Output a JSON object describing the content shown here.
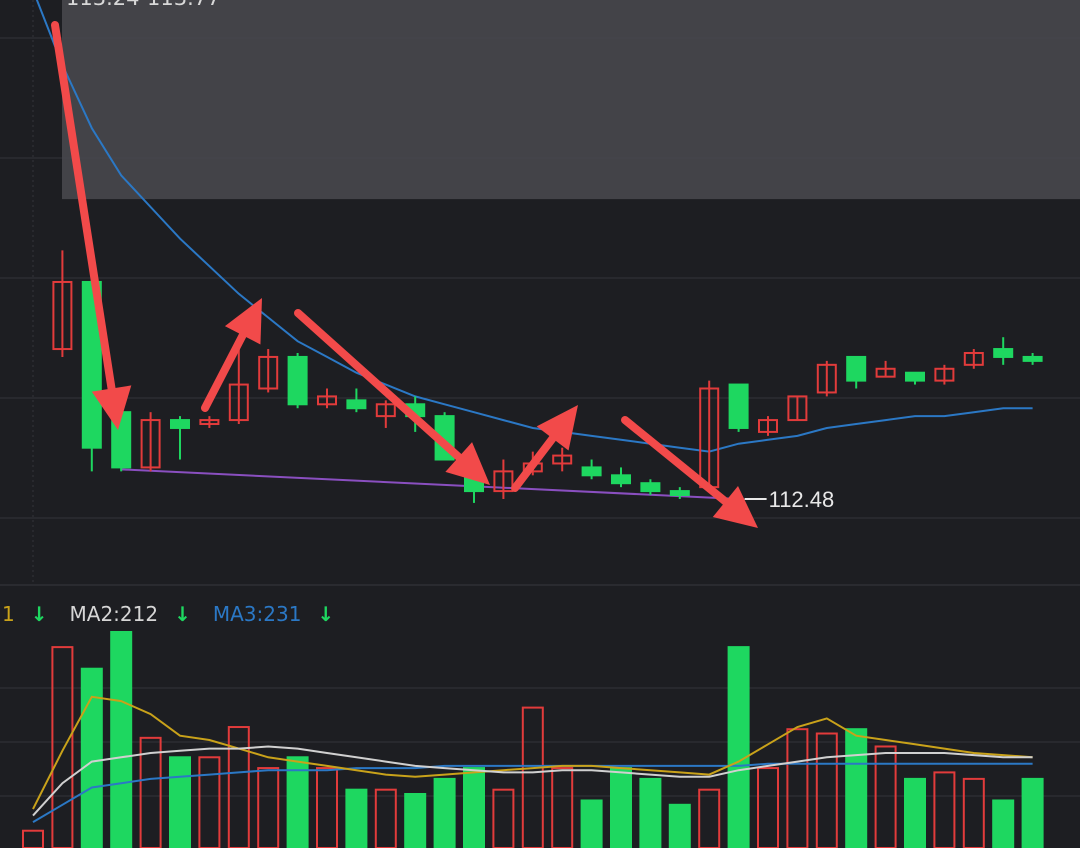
{
  "colors": {
    "background": "#1d1e22",
    "grid": "#33343a",
    "up": "#e23b3b",
    "down": "#1ed760",
    "ma_long": "#2b78c5",
    "ma_yellow": "#c9a21a",
    "ma_white": "#d0d0d0",
    "support_line": "#8a4fc0",
    "arrows": "#f24a4a",
    "zone": "#4a4a4f"
  },
  "header": {
    "range_text": "113.24-113.77"
  },
  "indicators": {
    "ma1_label": "1",
    "ma2_label": "MA2:212",
    "ma3_label": "MA3:231",
    "arrow_glyph": "↓"
  },
  "chart_data": [
    {
      "type": "candlestick",
      "title": "",
      "ylim": [
        112.3,
        113.77
      ],
      "resistance_zone": [
        113.24,
        113.77
      ],
      "low_annotation": "112.48",
      "candles": [
        {
          "o": 113.77,
          "c": 113.77,
          "h": 113.78,
          "l": 113.76
        },
        {
          "o": 112.86,
          "c": 113.03,
          "h": 113.11,
          "l": 112.84
        },
        {
          "o": 113.03,
          "c": 112.61,
          "h": 113.05,
          "l": 112.55
        },
        {
          "o": 112.7,
          "c": 112.56,
          "h": 112.71,
          "l": 112.55
        },
        {
          "o": 112.56,
          "c": 112.68,
          "h": 112.7,
          "l": 112.55
        },
        {
          "o": 112.68,
          "c": 112.66,
          "h": 112.69,
          "l": 112.58
        },
        {
          "o": 112.67,
          "c": 112.68,
          "h": 112.69,
          "l": 112.66
        },
        {
          "o": 112.68,
          "c": 112.77,
          "h": 112.87,
          "l": 112.67
        },
        {
          "o": 112.76,
          "c": 112.84,
          "h": 112.86,
          "l": 112.75
        },
        {
          "o": 112.84,
          "c": 112.72,
          "h": 112.85,
          "l": 112.71
        },
        {
          "o": 112.72,
          "c": 112.74,
          "h": 112.76,
          "l": 112.71
        },
        {
          "o": 112.73,
          "c": 112.71,
          "h": 112.76,
          "l": 112.7
        },
        {
          "o": 112.69,
          "c": 112.72,
          "h": 112.73,
          "l": 112.66
        },
        {
          "o": 112.72,
          "c": 112.69,
          "h": 112.74,
          "l": 112.65
        },
        {
          "o": 112.69,
          "c": 112.58,
          "h": 112.7,
          "l": 112.58
        },
        {
          "o": 112.55,
          "c": 112.5,
          "h": 112.56,
          "l": 112.47
        },
        {
          "o": 112.5,
          "c": 112.55,
          "h": 112.58,
          "l": 112.48
        },
        {
          "o": 112.55,
          "c": 112.57,
          "h": 112.6,
          "l": 112.54
        },
        {
          "o": 112.57,
          "c": 112.59,
          "h": 112.61,
          "l": 112.55
        },
        {
          "o": 112.56,
          "c": 112.54,
          "h": 112.58,
          "l": 112.53
        },
        {
          "o": 112.54,
          "c": 112.52,
          "h": 112.56,
          "l": 112.51
        },
        {
          "o": 112.52,
          "c": 112.5,
          "h": 112.53,
          "l": 112.49
        },
        {
          "o": 112.5,
          "c": 112.49,
          "h": 112.51,
          "l": 112.48
        },
        {
          "o": 112.51,
          "c": 112.76,
          "h": 112.78,
          "l": 112.5
        },
        {
          "o": 112.77,
          "c": 112.66,
          "h": 112.77,
          "l": 112.65
        },
        {
          "o": 112.65,
          "c": 112.68,
          "h": 112.69,
          "l": 112.64
        },
        {
          "o": 112.68,
          "c": 112.74,
          "h": 112.74,
          "l": 112.68
        },
        {
          "o": 112.75,
          "c": 112.82,
          "h": 112.83,
          "l": 112.74
        },
        {
          "o": 112.84,
          "c": 112.78,
          "h": 112.84,
          "l": 112.76
        },
        {
          "o": 112.79,
          "c": 112.81,
          "h": 112.83,
          "l": 112.79
        },
        {
          "o": 112.8,
          "c": 112.78,
          "h": 112.8,
          "l": 112.77
        },
        {
          "o": 112.78,
          "c": 112.81,
          "h": 112.82,
          "l": 112.77
        },
        {
          "o": 112.82,
          "c": 112.85,
          "h": 112.86,
          "l": 112.81
        },
        {
          "o": 112.86,
          "c": 112.84,
          "h": 112.89,
          "l": 112.82
        },
        {
          "o": 112.84,
          "c": 112.83,
          "h": 112.85,
          "l": 112.82
        }
      ],
      "ma_long": [
        113.77,
        113.58,
        113.42,
        113.3,
        113.22,
        113.14,
        113.07,
        113.0,
        112.94,
        112.88,
        112.84,
        112.8,
        112.77,
        112.74,
        112.72,
        112.7,
        112.68,
        112.66,
        112.65,
        112.64,
        112.63,
        112.62,
        112.61,
        112.6,
        112.62,
        112.63,
        112.64,
        112.66,
        112.67,
        112.68,
        112.69,
        112.69,
        112.7,
        112.71,
        112.71
      ]
    },
    {
      "type": "bar",
      "title": "volume",
      "ylim": [
        0,
        100
      ],
      "volumes": [
        8,
        93,
        83,
        100,
        51,
        42,
        42,
        56,
        37,
        42,
        37,
        27,
        27,
        25,
        32,
        37,
        27,
        65,
        37,
        22,
        37,
        32,
        20,
        27,
        93,
        37,
        55,
        53,
        55,
        47,
        32,
        35,
        32,
        22,
        32
      ],
      "ma_yellow": [
        18,
        45,
        70,
        68,
        62,
        52,
        50,
        46,
        42,
        40,
        38,
        36,
        34,
        33,
        34,
        35,
        36,
        37,
        38,
        38,
        37,
        36,
        35,
        34,
        40,
        48,
        56,
        60,
        52,
        50,
        48,
        46,
        44,
        43,
        42
      ],
      "ma_white": [
        15,
        30,
        40,
        42,
        44,
        45,
        46,
        46,
        47,
        46,
        44,
        42,
        40,
        38,
        37,
        36,
        35,
        35,
        36,
        36,
        35,
        34,
        33,
        33,
        36,
        38,
        40,
        42,
        43,
        44,
        44,
        44,
        43,
        42,
        42
      ],
      "ma_blue": [
        12,
        20,
        28,
        30,
        32,
        33,
        34,
        35,
        36,
        36,
        36,
        37,
        37,
        37,
        38,
        38,
        38,
        38,
        38,
        38,
        38,
        38,
        38,
        38,
        38,
        39,
        39,
        39,
        39,
        39,
        39,
        39,
        39,
        39,
        39
      ]
    }
  ]
}
